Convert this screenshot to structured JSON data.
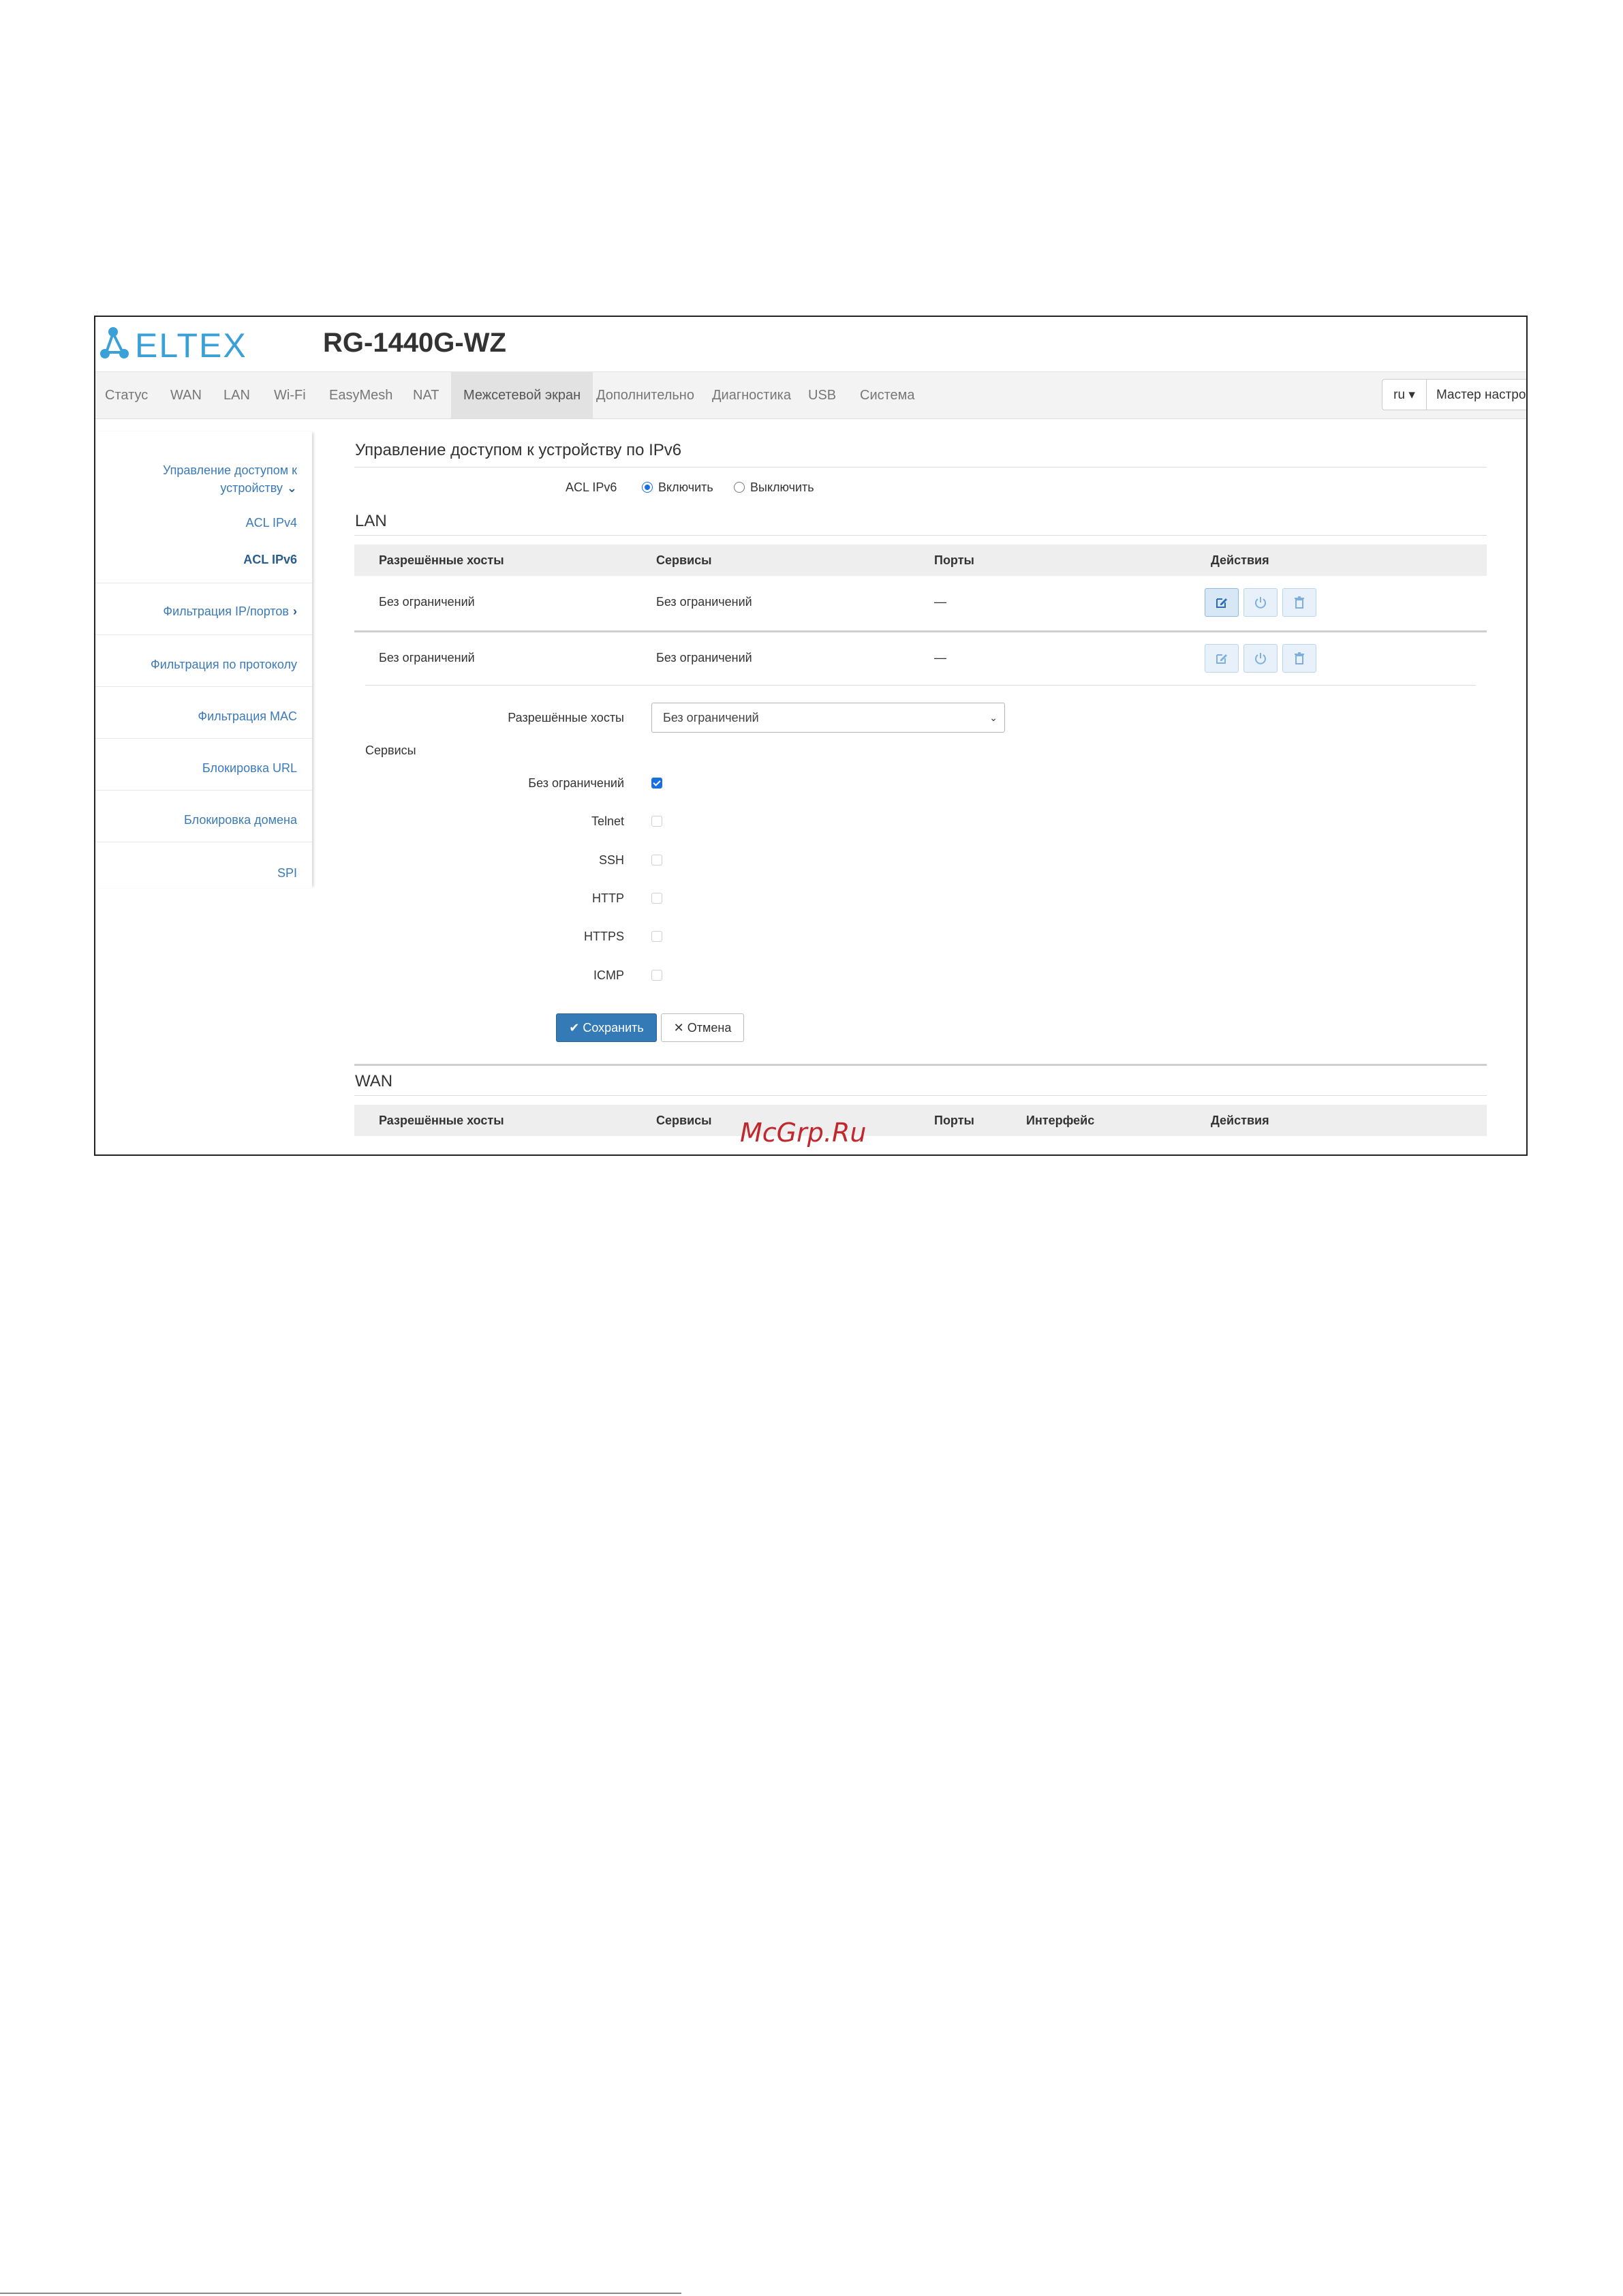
{
  "brand": {
    "logo_text": "ELTEX",
    "model": "RG-1440G-WZ"
  },
  "nav": {
    "items": [
      "Статус",
      "WAN",
      "LAN",
      "Wi-Fi",
      "EasyMesh",
      "NAT",
      "Межсетевой экран",
      "Дополнительно",
      "Диагностика",
      "USB",
      "Система"
    ],
    "active": "Межсетевой экран",
    "lang": "ru ▾",
    "wizard": "Мастер настройки"
  },
  "sidebar": {
    "group_title_line1": "Управление доступом к",
    "group_title_line2": "устройству",
    "sub_items": [
      "ACL IPv4",
      "ACL IPv6"
    ],
    "items": [
      "Фильтрация IP/портов",
      "Фильтрация по протоколу",
      "Фильтрация MAC",
      "Блокировка URL",
      "Блокировка домена",
      "SPI"
    ]
  },
  "main": {
    "title": "Управление доступом к устройству по IPv6",
    "acl_label": "ACL IPv6",
    "radio_on": "Включить",
    "radio_off": "Выключить",
    "acl_enabled": true,
    "lan_title": "LAN",
    "wan_title": "WAN",
    "table_headers": {
      "hosts": "Разрешённые хосты",
      "services": "Сервисы",
      "ports": "Порты",
      "iface": "Интерфейс",
      "actions": "Действия"
    },
    "lan_rows": [
      {
        "hosts": "Без ограничений",
        "services": "Без ограничений",
        "ports": "—"
      },
      {
        "hosts": "Без ограничений",
        "services": "Без ограничений",
        "ports": "—"
      }
    ],
    "form": {
      "hosts_label": "Разрешённые хосты",
      "hosts_value": "Без ограничений",
      "services_title": "Сервисы",
      "services": [
        {
          "label": "Без ограничений",
          "checked": true
        },
        {
          "label": "Telnet",
          "checked": false
        },
        {
          "label": "SSH",
          "checked": false
        },
        {
          "label": "HTTP",
          "checked": false
        },
        {
          "label": "HTTPS",
          "checked": false
        },
        {
          "label": "ICMP",
          "checked": false
        }
      ],
      "save": "Сохранить",
      "cancel": "Отмена"
    }
  },
  "watermark": "McGrp.Ru",
  "colors": {
    "link": "#3b7ab8",
    "primary": "#337ab7",
    "logo": "#3aa0d8",
    "watermark": "#c0282e"
  }
}
